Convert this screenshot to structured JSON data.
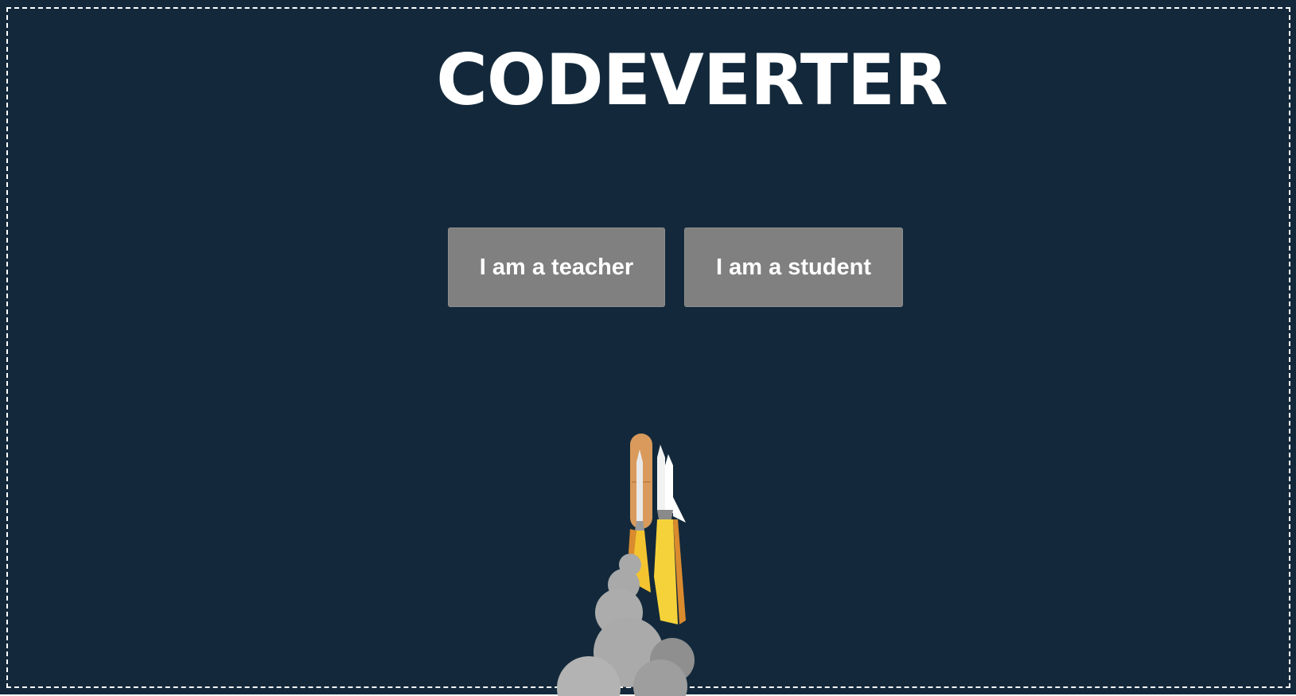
{
  "app": {
    "title": "CODEVERTER"
  },
  "buttons": {
    "teacher_label": "I am a teacher",
    "student_label": "I am a student"
  },
  "colors": {
    "background": "#13293b",
    "button": "#808080",
    "text": "#ffffff",
    "booster": "#d99a5b",
    "flame": "#f4c430",
    "smoke": "#aaaaaa"
  },
  "illustration": {
    "icon": "rocket-launch-icon"
  }
}
